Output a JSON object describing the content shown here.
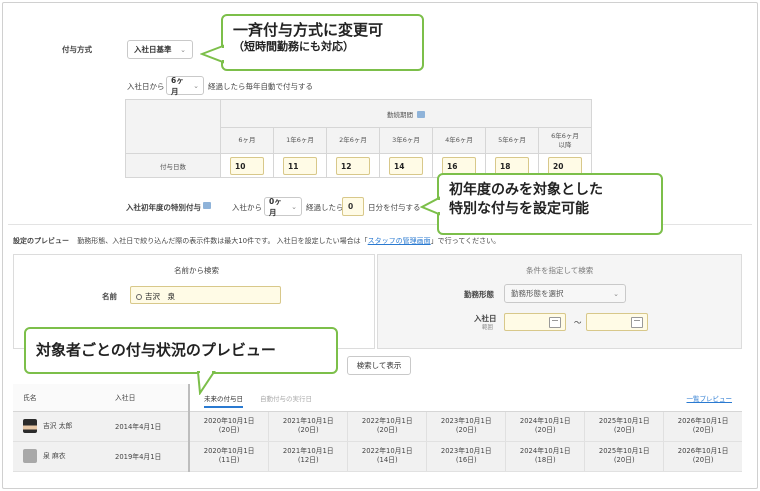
{
  "grant_method": {
    "label": "付与方式",
    "selected": "入社日基準"
  },
  "first_grant": {
    "prefix": "入社日から",
    "months_selected": "6ヶ月",
    "suffix": "経過したら毎年自動で付与する"
  },
  "grant_table": {
    "header": "勤続期間",
    "periods": [
      "6ヶ月",
      "1年6ヶ月",
      "2年6ヶ月",
      "3年6ヶ月",
      "4年6ヶ月",
      "5年6ヶ月",
      "6年6ヶ月\n以降"
    ],
    "row_label": "付与日数",
    "days": [
      "10",
      "11",
      "12",
      "14",
      "16",
      "18",
      "20"
    ]
  },
  "special_first_year": {
    "label": "入社初年度の特別付与",
    "prefix": "入社から",
    "months_selected": "0ヶ月",
    "middle": "経過したら",
    "days_value": "0",
    "suffix": "日分を付与する"
  },
  "preview_note": {
    "title": "設定のプレビュー",
    "text": "勤務形態、入社日で絞り込んだ際の表示件数は最大10件です。 入社日を設定したい場合は「",
    "link": "スタッフの管理画面",
    "text_end": "」で行ってください。"
  },
  "search_by_name": {
    "title": "名前から検索",
    "field_label": "名前",
    "field_value": "吉沢　泉"
  },
  "search_by_condition": {
    "title": "条件を指定して検索",
    "work_type_label": "勤務形態",
    "work_type_placeholder": "勤務形態を選択",
    "join_date_label": "入社日",
    "join_date_sub": "範囲",
    "range_sep": "〜"
  },
  "search_button": "検索して表示",
  "results": {
    "col_name": "氏名",
    "col_join": "入社日",
    "tab_future": "未来の付与日",
    "tab_auto": "自動付与の実行日",
    "list_preview": "一覧プレビュー",
    "rows": [
      {
        "name": "吉沢 太郎",
        "join_date": "2014年4月1日",
        "grants": [
          {
            "date": "2020年10月1日",
            "days": "(20日)"
          },
          {
            "date": "2021年10月1日",
            "days": "(20日)"
          },
          {
            "date": "2022年10月1日",
            "days": "(20日)"
          },
          {
            "date": "2023年10月1日",
            "days": "(20日)"
          },
          {
            "date": "2024年10月1日",
            "days": "(20日)"
          },
          {
            "date": "2025年10月1日",
            "days": "(20日)"
          },
          {
            "date": "2026年10月1日",
            "days": "(20日)"
          }
        ]
      },
      {
        "name": "泉 麻衣",
        "join_date": "2019年4月1日",
        "grants": [
          {
            "date": "2020年10月1日",
            "days": "(11日)"
          },
          {
            "date": "2021年10月1日",
            "days": "(12日)"
          },
          {
            "date": "2022年10月1日",
            "days": "(14日)"
          },
          {
            "date": "2023年10月1日",
            "days": "(16日)"
          },
          {
            "date": "2024年10月1日",
            "days": "(18日)"
          },
          {
            "date": "2025年10月1日",
            "days": "(20日)"
          },
          {
            "date": "2026年10月1日",
            "days": "(20日)"
          }
        ]
      }
    ]
  },
  "callouts": {
    "top_line1": "一斉付与方式に変更可",
    "top_line2": "（短時間勤務にも対応）",
    "middle_line1": "初年度のみを対象とした",
    "middle_line2": "特別な付与を設定可能",
    "bottom": "対象者ごとの付与状況のプレビュー"
  },
  "colors": {
    "callout_border": "#7cbf4a",
    "input_fill": "#fffbe6",
    "link": "#2a7ad1",
    "tab_underline": "#2a7ad1"
  }
}
